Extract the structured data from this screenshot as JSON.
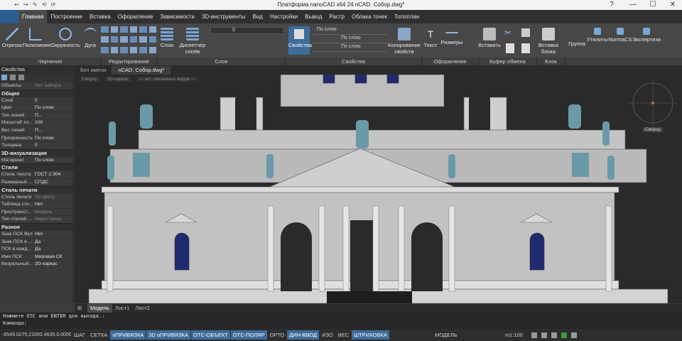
{
  "title_bar": {
    "title": "Платформа nanoCAD x64 24 nCAD. Собор.dwg*",
    "qat": "↩ ↪ ✎ ⟲ ⟳"
  },
  "menu": [
    {
      "label": "Главная",
      "active": true
    },
    {
      "label": "Построение"
    },
    {
      "label": "Вставка"
    },
    {
      "label": "Оформление"
    },
    {
      "label": "Зависимости"
    },
    {
      "label": "3D-инструменты"
    },
    {
      "label": "Вид"
    },
    {
      "label": "Настройки"
    },
    {
      "label": "Вывод"
    },
    {
      "label": "Растр"
    },
    {
      "label": "Облака точек"
    },
    {
      "label": "Топоплан"
    }
  ],
  "ribbon": {
    "otrezok": "Отрезок",
    "polyline": "Полилиния",
    "circle": "Окружность",
    "arc": "Дуга",
    "layers": "Слои",
    "layer_mgr": "Диспетчер слоёв",
    "properties": "Свойства",
    "copy_props": "Копирование свойств",
    "text": "Текст",
    "sizes": "Размеры",
    "insert": "Вставить",
    "insert_block": "Вставка блока",
    "group": "Группа",
    "utils": "Утилиты",
    "normacs": "NormaCS",
    "expert": "Экспертиза",
    "by_layer1": "По слою",
    "by_layer2": "По слою",
    "by_layer3": "По слою",
    "layer_num": "0"
  },
  "groups": [
    "Черчение",
    "Редактирование",
    "Слои",
    "Свойства",
    "Оформление",
    "Буфер обмена",
    "Блок"
  ],
  "doc_tabs": [
    {
      "label": "Без имени"
    },
    {
      "label": "nCAD. Собор.dwg*",
      "active": true
    }
  ],
  "viewport_info": [
    "Сверху",
    "2D-каркас",
    "--- нет связанных видов ---"
  ],
  "viewcube_label": "Сверху",
  "properties_panel": {
    "title": "Свойства",
    "objects_k": "Объекты",
    "objects_v": "Нет набора",
    "sections": [
      {
        "name": "Общие",
        "rows": [
          {
            "k": "Слой",
            "v": "0"
          },
          {
            "k": "Цвет",
            "v": "По слою"
          },
          {
            "k": "Тип линий",
            "v": "П..."
          },
          {
            "k": "Масштаб ти...",
            "v": "100"
          },
          {
            "k": "Вес линий",
            "v": "П..."
          },
          {
            "k": "Прозрачность",
            "v": "По слою"
          },
          {
            "k": "Толщина",
            "v": "0"
          }
        ]
      },
      {
        "name": "3D-визуализация",
        "rows": [
          {
            "k": "Материал",
            "v": "По слою"
          }
        ]
      },
      {
        "name": "Стили",
        "rows": [
          {
            "k": "Стиль текста",
            "v": "ГОСТ 2.304"
          },
          {
            "k": "Размерный ...",
            "v": "СПДС"
          }
        ]
      },
      {
        "name": "Стиль печати",
        "rows": [
          {
            "k": "Стиль печати",
            "v": "По цвету",
            "dim": true
          },
          {
            "k": "Таблица сти...",
            "v": "Нет"
          },
          {
            "k": "Пространст...",
            "v": "Модель",
            "dim": true
          },
          {
            "k": "Тип стилей ...",
            "v": "Недоступно",
            "dim": true
          }
        ]
      },
      {
        "name": "Разное",
        "rows": [
          {
            "k": "Знак ПСК Вкл",
            "v": "Нет"
          },
          {
            "k": "Знак ПСК в ...",
            "v": "Да"
          },
          {
            "k": "ПСК в кажд...",
            "v": "Да"
          },
          {
            "k": "Имя ПСК",
            "v": "Мировая СК"
          },
          {
            "k": "Визуальный...",
            "v": "2D-каркас"
          }
        ]
      }
    ]
  },
  "layout_tabs": [
    {
      "label": "Модель",
      "active": true
    },
    {
      "label": "Лист1"
    },
    {
      "label": "Лист2"
    }
  ],
  "command_line": {
    "line1": "Нажмите  ESC или ENTER для выхода.:",
    "line2": "Команда:"
  },
  "status_bar": {
    "coords": "-6549.0275,21692.4635,0.0000",
    "toggles": [
      {
        "label": "ШАГ"
      },
      {
        "label": "СЕТКА"
      },
      {
        "label": "оПРИВЯЗКА",
        "on": true
      },
      {
        "label": "3D оПРИВЯЗКА",
        "on": true
      },
      {
        "label": "ОТС-ОБЪЕКТ",
        "on": true
      },
      {
        "label": "ОТС-ПОЛЯР",
        "on": true
      },
      {
        "label": "ОРТО"
      },
      {
        "label": "ДИН-ВВОД",
        "on": true
      },
      {
        "label": "ИЗО"
      },
      {
        "label": "ВЕС"
      },
      {
        "label": "ШТРИХОВКА",
        "on": true
      }
    ],
    "model_label": "МОДЕЛЬ",
    "scale": "m1:100"
  }
}
